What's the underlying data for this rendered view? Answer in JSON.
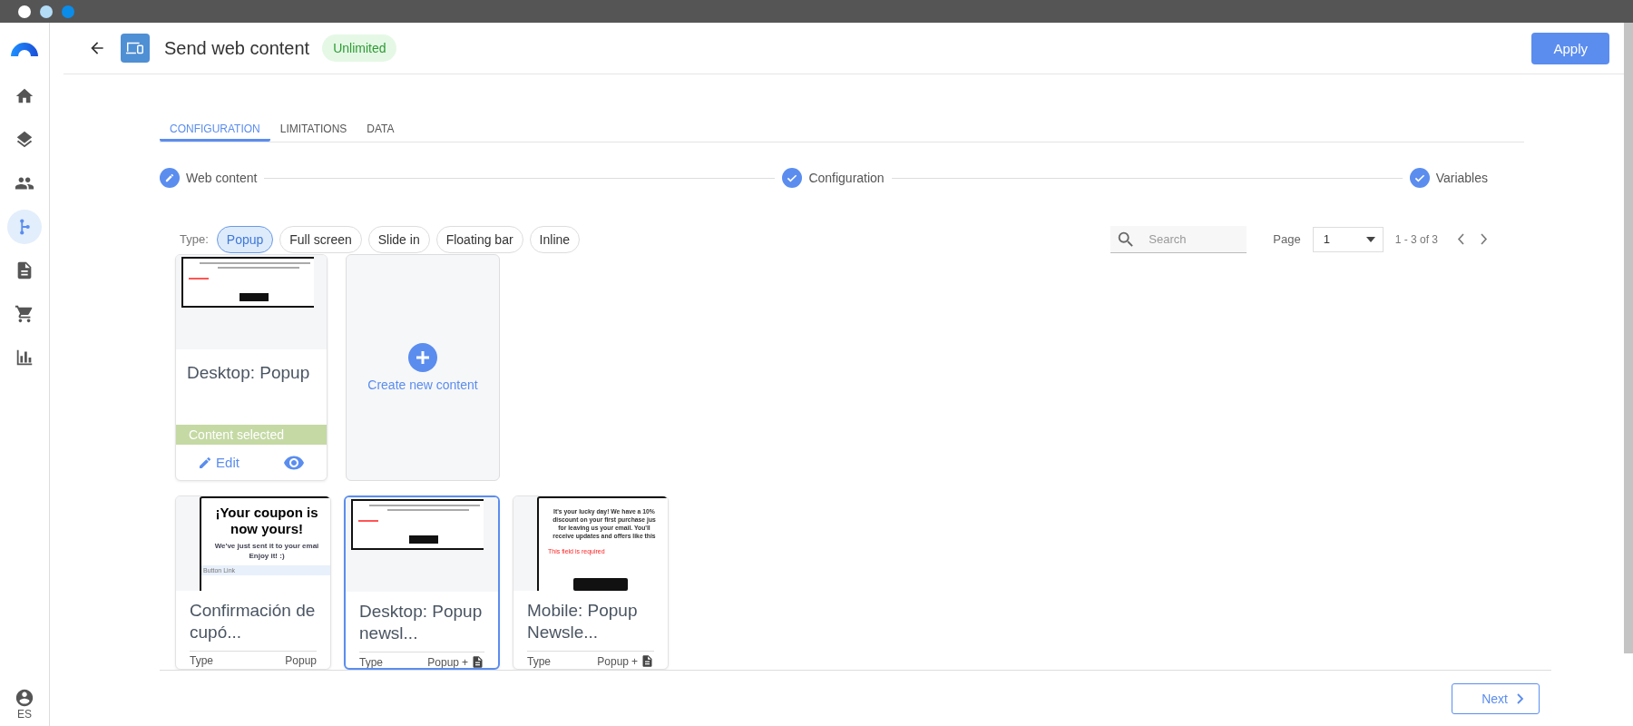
{
  "window": {
    "controls": [
      {
        "color": "#ffffff"
      },
      {
        "color": "#b3dcf7"
      },
      {
        "color": "#0b8ce9"
      }
    ]
  },
  "sidebar": {
    "items": [
      {
        "kind": "home",
        "selected": false
      },
      {
        "kind": "layers",
        "selected": false
      },
      {
        "kind": "people",
        "selected": false
      },
      {
        "kind": "flow",
        "selected": true
      },
      {
        "kind": "document",
        "selected": false
      },
      {
        "kind": "cart",
        "selected": false
      },
      {
        "kind": "chart",
        "selected": false
      }
    ],
    "user": {
      "label": "ES"
    }
  },
  "header": {
    "title": "Send web content",
    "badge": "Unlimited",
    "apply_button": "Apply"
  },
  "tabs": [
    {
      "label": "CONFIGURATION",
      "selected": true
    },
    {
      "label": "LIMITATIONS",
      "selected": false
    },
    {
      "label": "DATA",
      "selected": false
    }
  ],
  "steps": [
    {
      "label": "Web content",
      "kind": "edit"
    },
    {
      "label": "Configuration",
      "kind": "done"
    },
    {
      "label": "Variables",
      "kind": "done"
    }
  ],
  "filters": {
    "label": "Type:",
    "chips": [
      {
        "label": "Popup",
        "selected": true
      },
      {
        "label": "Full screen",
        "selected": false
      },
      {
        "label": "Slide in",
        "selected": false
      },
      {
        "label": "Floating bar",
        "selected": false
      },
      {
        "label": "Inline",
        "selected": false
      }
    ]
  },
  "search": {
    "placeholder": "Search"
  },
  "pagination": {
    "label": "Page",
    "page": "1",
    "range": "1 - 3 of 3"
  },
  "card_rows": [
    [
      {
        "kind": "current",
        "title": "Desktop: Popup",
        "preview": {
          "kind": "desktop"
        },
        "banner": "Content selected",
        "edit": "Edit"
      },
      {
        "kind": "create",
        "label": "Create new content"
      }
    ],
    [
      {
        "kind": "item",
        "title": "Confirmación de cupó...",
        "selected": false,
        "preview": {
          "kind": "coupon",
          "heading": "¡Your coupon is now yours!",
          "lines": [
            "We've just sent it to your emai",
            "Enjoy it! :)"
          ],
          "link": "Button Link"
        },
        "type_label": "Type",
        "type_value": "Popup",
        "attachment": false
      },
      {
        "kind": "item",
        "title": "Desktop: Popup newsl...",
        "selected": true,
        "preview": {
          "kind": "desktop"
        },
        "type_label": "Type",
        "type_value": "Popup",
        "extra": "+",
        "attachment": true
      },
      {
        "kind": "item",
        "title": "Mobile: Popup Newsle...",
        "selected": false,
        "preview": {
          "kind": "mobile",
          "lines": [
            "It's your lucky day! We have a 10%",
            "discount on your first purchase jus",
            "for leaving us your email. You'll",
            "receive updates and offers like this"
          ],
          "error": "This field is required"
        },
        "type_label": "Type",
        "type_value": "Popup",
        "extra": "+",
        "attachment": true
      }
    ]
  ],
  "footer": {
    "next_button": "Next"
  }
}
